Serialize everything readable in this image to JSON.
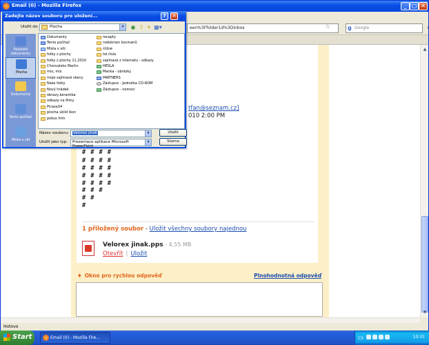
{
  "firefox": {
    "title": "Email (0) - Mozilla Firefox",
    "url": "een%3Ffolder1d%3Dinbox",
    "search_placeholder": "Google",
    "status": "Hotovo"
  },
  "email": {
    "address_fragment": "tfan@seznam.cz]",
    "date_fragment": "010 2:00 PM",
    "hash_lines": [
      "# # # #",
      "# # # #",
      "# # # #",
      "# # # #",
      "# # # #",
      "# # #",
      "# #",
      "#"
    ],
    "attachment_count": "1 přiložený soubor",
    "attachment_sep": " - ",
    "save_all_link": "Uložit všechny soubory najednou",
    "file_name": "Velorex jinak.pps",
    "file_size": " - 4,55 MB",
    "open_link": "Otevřít",
    "link_sep": "|",
    "save_link": "Uložit",
    "quick_reply_title": "Okno pro rychlou odpověď",
    "full_reply_link": "Plnohodnotná odpověď"
  },
  "dialog": {
    "title": "Zadejte název souboru pro uložení...",
    "save_in_label": "Uložit do:",
    "save_in_value": "Plocha",
    "places": [
      {
        "label": "Poslední dokumenty",
        "icon": "recent-docs-icon",
        "color": "#5a86d8"
      },
      {
        "label": "Plocha",
        "icon": "desktop-icon",
        "color": "#3f7ad6"
      },
      {
        "label": "Dokumenty",
        "icon": "my-documents-icon",
        "color": "#f2c94c"
      },
      {
        "label": "Tento počítač",
        "icon": "my-computer-icon",
        "color": "#5f8fd8"
      },
      {
        "label": "Místa v síti",
        "icon": "network-places-icon",
        "color": "#6aa0e0"
      }
    ],
    "files_col1": [
      {
        "name": "Dokumenty",
        "type": "sp"
      },
      {
        "name": "Tento počítač",
        "type": "sp"
      },
      {
        "name": "Místa v síti",
        "type": "net"
      },
      {
        "name": "fotky z plochy",
        "type": "folder"
      },
      {
        "name": "fotky z plochy 11.2010",
        "type": "folder"
      },
      {
        "name": "Chorvatsko Martin",
        "type": "folder"
      },
      {
        "name": "mix, mix",
        "type": "folder"
      },
      {
        "name": "moje zajímavé skeny",
        "type": "folder"
      },
      {
        "name": "Naše fotky",
        "type": "folder"
      },
      {
        "name": "Nový hrádek",
        "type": "folder"
      },
      {
        "name": "obrazy,keramika",
        "type": "folder"
      },
      {
        "name": "odkazy na filmy",
        "type": "folder"
      },
      {
        "name": "Picasa34",
        "type": "folder"
      },
      {
        "name": "plocha úklid ikon",
        "type": "folder"
      },
      {
        "name": "pokus htm",
        "type": "folder"
      }
    ],
    "files_col2": [
      {
        "name": "recepty",
        "type": "folder"
      },
      {
        "name": "rodokmen kocmanů",
        "type": "folder"
      },
      {
        "name": "růžné",
        "type": "folder"
      },
      {
        "name": "tel.čísla",
        "type": "folder"
      },
      {
        "name": "zajímavé z internetu - odkazy",
        "type": "folder"
      },
      {
        "name": "HESLA",
        "type": "pic"
      },
      {
        "name": "Manka - obrázky",
        "type": "pic"
      },
      {
        "name": "PARTNERS",
        "type": "sp"
      },
      {
        "name": "Zástupce - Jednotka CD-ROM",
        "type": "cd"
      },
      {
        "name": "Zástupce - nemoci",
        "type": "pic"
      }
    ],
    "filename_label": "Název souboru:",
    "filename_value": "Velorex jinak",
    "filetype_label": "Uložit jako typ:",
    "filetype_value": "Prezentace aplikace Microsoft PowerPoint",
    "save_button": "Uložit",
    "cancel_button": "Storno"
  },
  "taskbar": {
    "start": "Start",
    "firefox_task": "Email (0) - Mozilla Fire...",
    "lang": "CS",
    "clock": "10:31"
  }
}
